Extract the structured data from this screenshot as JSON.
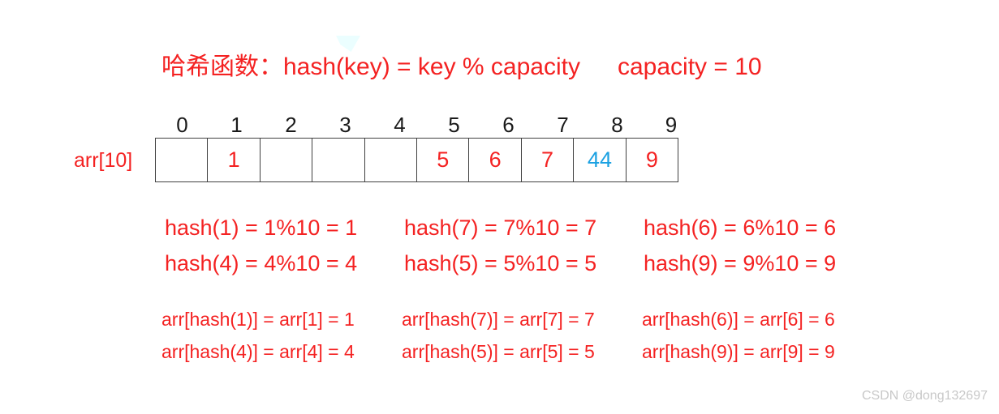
{
  "colors": {
    "red": "#f42222",
    "blue": "#1ba1e2",
    "index_black": "#1a1a1a",
    "border": "#404040",
    "watermark": "#c8c8c8",
    "background": "#ffffff"
  },
  "title": {
    "formula": "哈希函数：hash(key) = key % capacity",
    "capacity": "capacity = 10"
  },
  "array": {
    "label": "arr[10]",
    "indices": [
      "0",
      "1",
      "2",
      "3",
      "4",
      "5",
      "6",
      "7",
      "8",
      "9"
    ],
    "cells": [
      {
        "index": "0",
        "value": "",
        "color": "red"
      },
      {
        "index": "1",
        "value": "1",
        "color": "red"
      },
      {
        "index": "2",
        "value": "",
        "color": "red"
      },
      {
        "index": "3",
        "value": "",
        "color": "red"
      },
      {
        "index": "4",
        "value": "",
        "color": "red"
      },
      {
        "index": "5",
        "value": "5",
        "color": "red"
      },
      {
        "index": "6",
        "value": "6",
        "color": "red"
      },
      {
        "index": "7",
        "value": "7",
        "color": "red"
      },
      {
        "index": "8",
        "value": "44",
        "color": "blue"
      },
      {
        "index": "9",
        "value": "9",
        "color": "red"
      }
    ]
  },
  "hash_equations": {
    "row1": [
      "hash(1) = 1%10 = 1",
      "hash(7) = 7%10 = 7",
      "hash(6) = 6%10 = 6"
    ],
    "row2": [
      "hash(4) = 4%10 = 4",
      "hash(5) = 5%10 = 5",
      "hash(9) = 9%10 = 9"
    ]
  },
  "arr_equations": {
    "row1": [
      "arr[hash(1)] = arr[1] = 1",
      "arr[hash(7)] = arr[7] = 7",
      "arr[hash(6)] = arr[6] = 6"
    ],
    "row2": [
      "arr[hash(4)] = arr[4] = 4",
      "arr[hash(5)] = arr[5] = 5",
      "arr[hash(9)] = arr[9] = 9"
    ]
  },
  "watermark": "CSDN @dong132697"
}
